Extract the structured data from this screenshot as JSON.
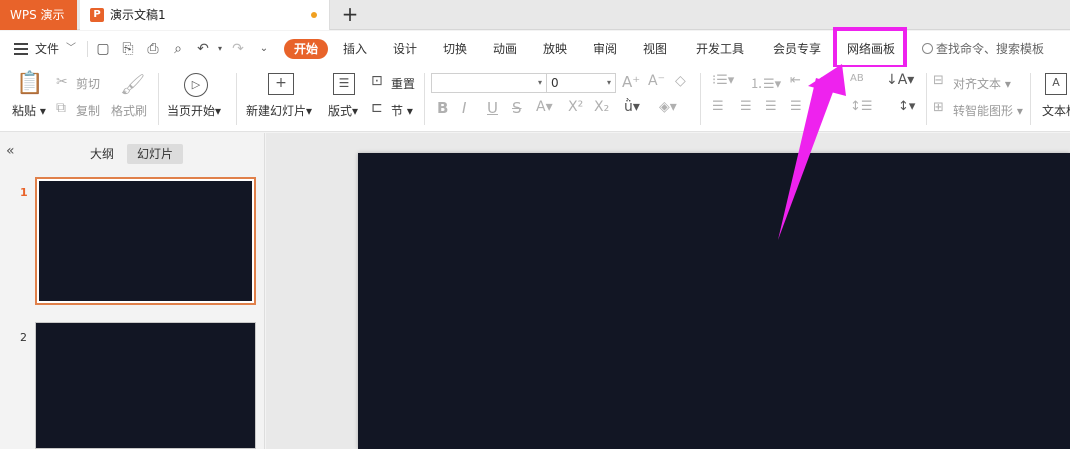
{
  "titlebar": {
    "app_name": "WPS 演示",
    "doc_icon": "P",
    "doc_title": "演示文稿1",
    "add_tab": "+"
  },
  "menu": {
    "file_label": "文件",
    "tabs": [
      {
        "label": "开始",
        "active": true
      },
      {
        "label": "插入"
      },
      {
        "label": "设计"
      },
      {
        "label": "切换"
      },
      {
        "label": "动画"
      },
      {
        "label": "放映"
      },
      {
        "label": "审阅"
      },
      {
        "label": "视图"
      },
      {
        "label": "开发工具"
      },
      {
        "label": "会员专享"
      },
      {
        "label": "网络画板"
      }
    ],
    "search_label": "查找命令、搜索模板"
  },
  "ribbon": {
    "paste": "粘贴",
    "cut": "剪切",
    "copy": "复制",
    "format_painter": "格式刷",
    "from_current": "当页开始",
    "new_slide": "新建幻灯片",
    "layout": "版式",
    "reset": "重置",
    "section": "节",
    "font_name": "",
    "font_size": "0",
    "align_text": "对齐文本",
    "smartart": "转智能图形",
    "textbox": "文本框"
  },
  "leftpanel": {
    "outline_tab": "大纲",
    "slides_tab": "幻灯片",
    "slides": [
      {
        "number": "1",
        "active": true
      },
      {
        "number": "2",
        "active": false
      }
    ]
  },
  "colors": {
    "accent": "#e8632a",
    "slide_bg": "#121624",
    "annotation": "#ee22ee"
  }
}
